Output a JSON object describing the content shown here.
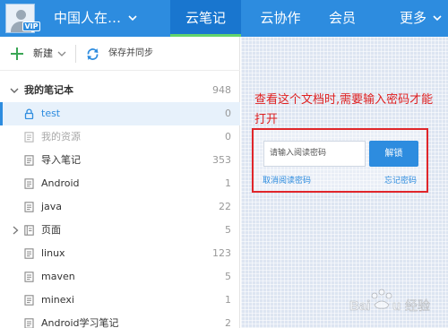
{
  "header": {
    "user_name": "中国人在…",
    "vip_badge": "VIP",
    "tabs": [
      {
        "label": "云笔记"
      },
      {
        "label": "云协作"
      },
      {
        "label": "会员"
      },
      {
        "label": "更多"
      }
    ]
  },
  "toolbar": {
    "new_label": "新建",
    "sync_label": "保存并同步"
  },
  "notebook": {
    "title": "我的笔记本",
    "count": "948",
    "items": [
      {
        "label": "test",
        "count": "0",
        "icon": "lock-icon"
      },
      {
        "label": "我的资源",
        "count": "0",
        "icon": "document-icon"
      },
      {
        "label": "导入笔记",
        "count": "353",
        "icon": "document-icon"
      },
      {
        "label": "Android",
        "count": "1",
        "icon": "document-icon"
      },
      {
        "label": "java",
        "count": "22",
        "icon": "document-icon"
      },
      {
        "label": "页面",
        "count": "5",
        "icon": "folder-icon"
      },
      {
        "label": "linux",
        "count": "123",
        "icon": "document-icon"
      },
      {
        "label": "maven",
        "count": "5",
        "icon": "document-icon"
      },
      {
        "label": "minexi",
        "count": "1",
        "icon": "document-icon"
      },
      {
        "label": "Android学习笔记",
        "count": "2",
        "icon": "document-icon"
      }
    ]
  },
  "content": {
    "annotation": "查看这个文档时,需要输入密码才能打开",
    "password": {
      "placeholder": "请输入阅读密码",
      "unlock_label": "解锁",
      "cancel_label": "取消阅读密码",
      "forgot_label": "忘记密码"
    }
  },
  "watermark": {
    "text": "Baidu 经验"
  },
  "colors": {
    "accent": "#2d8cdf",
    "active_tab": "#1976cf",
    "tab_indicator": "#62d36c",
    "annotation_red": "#e02020"
  }
}
